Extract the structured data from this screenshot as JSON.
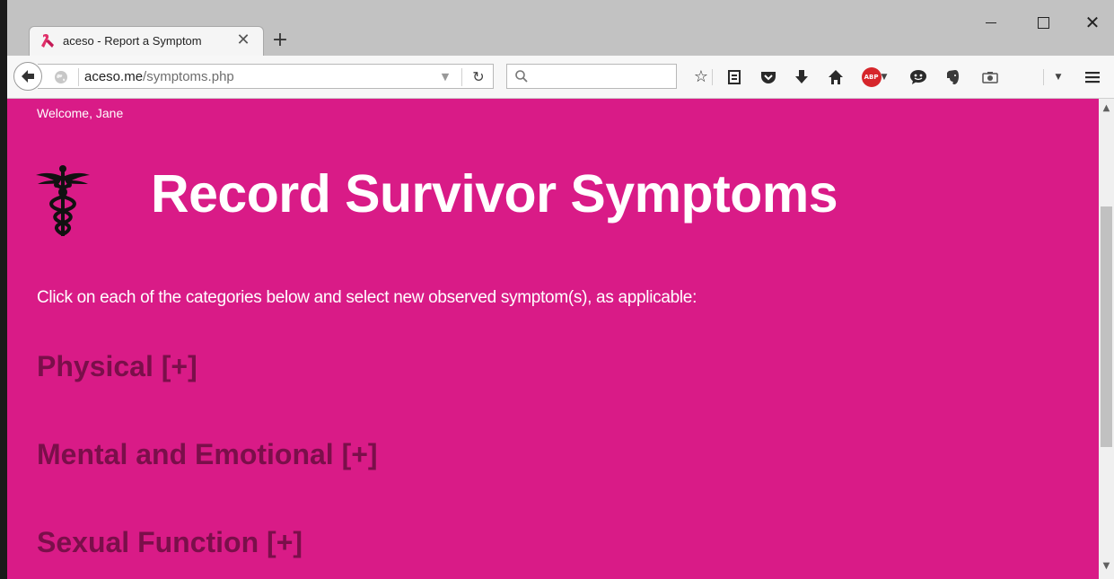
{
  "browser": {
    "tab": {
      "title": "aceso - Report a Symptom",
      "close": "✕"
    },
    "new_tab": "+",
    "url": {
      "host": "aceso.me",
      "path": "/symptoms.php"
    }
  },
  "page": {
    "welcome": "Welcome, Jane",
    "title": "Record Survivor Symptoms",
    "instructions": "Click on each of the categories below and select new observed symptom(s), as applicable:",
    "categories": [
      {
        "label": "Physical [+]"
      },
      {
        "label": "Mental and Emotional [+]"
      },
      {
        "label": "Sexual Function [+]"
      }
    ]
  },
  "colors": {
    "page_background": "#d91b87",
    "category_text": "#7a0f4a",
    "title_text": "#ffffff",
    "abp_badge": "#d6262b"
  },
  "icons": {
    "tab": "pink-ribbon-icon",
    "logo": "caduceus-icon",
    "toolbar": [
      "bookmark-star-icon",
      "reading-list-icon",
      "pocket-icon",
      "download-icon",
      "home-icon",
      "adblock-plus-icon",
      "chat-icon",
      "evernote-icon",
      "screenshot-icon",
      "menu-icon"
    ]
  }
}
